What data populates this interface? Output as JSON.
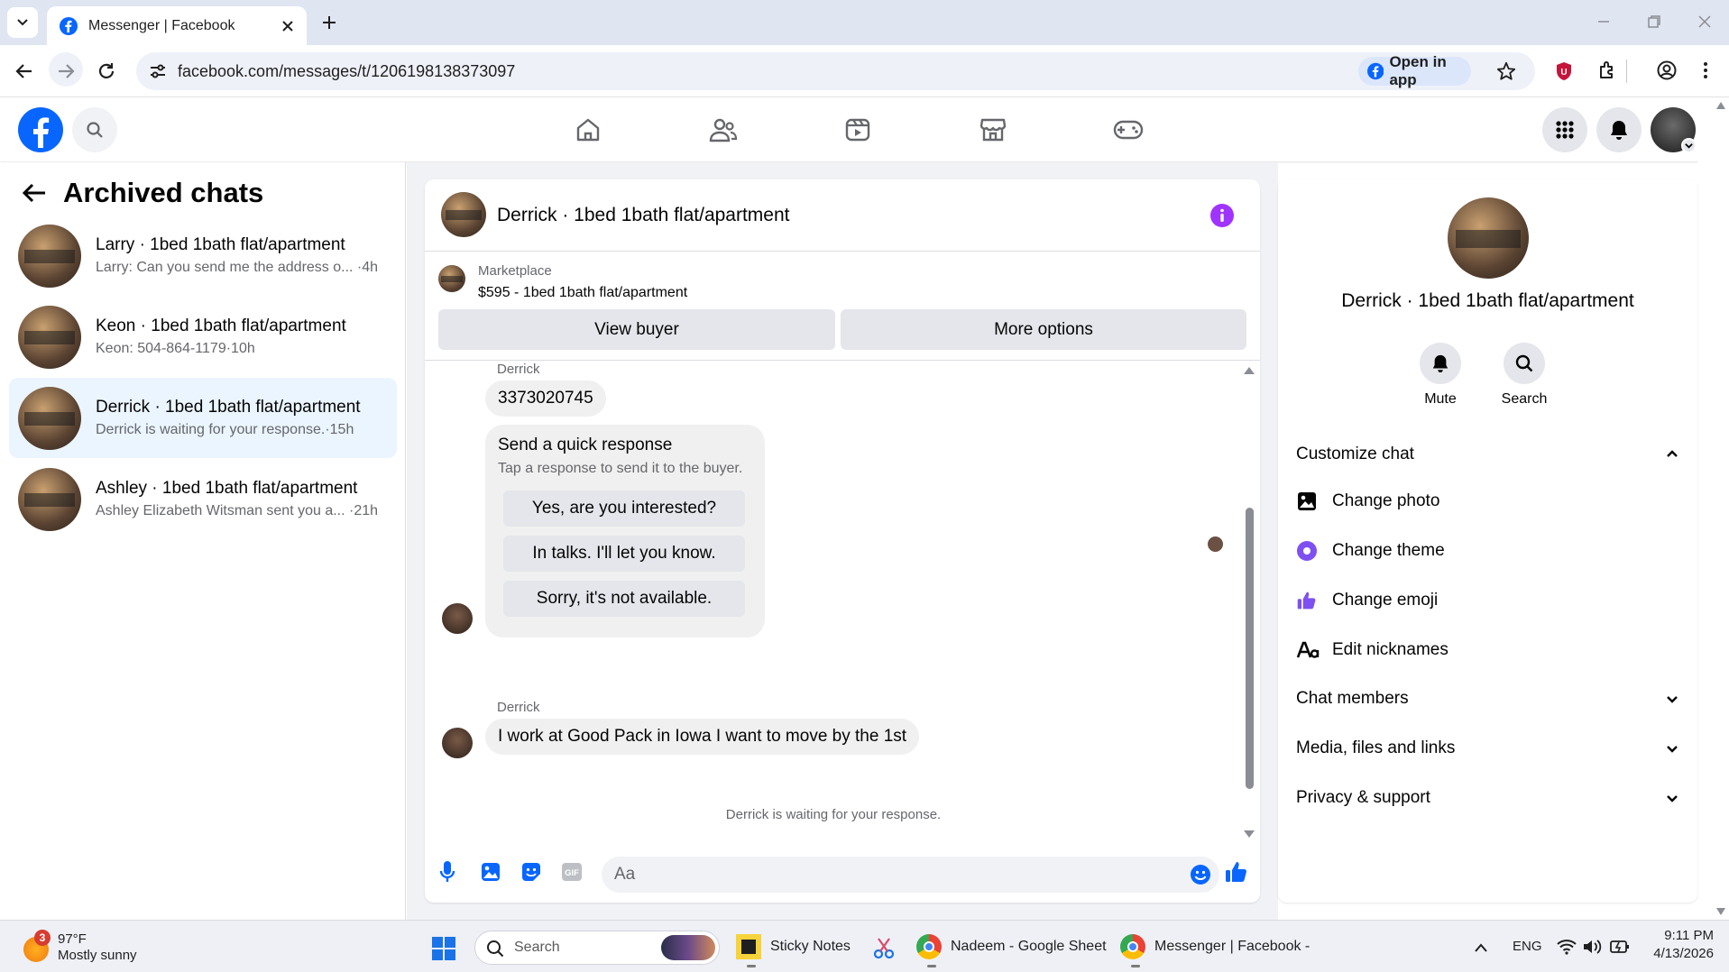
{
  "browser": {
    "tab_title": "Messenger | Facebook",
    "url": "facebook.com/messages/t/1206198138373097",
    "open_in_app": "Open in app"
  },
  "left": {
    "title": "Archived chats",
    "chats": [
      {
        "name": "Larry · 1bed 1bath flat/apartment",
        "preview": "Larry: Can you send me the address o... ·4h"
      },
      {
        "name": "Keon · 1bed 1bath flat/apartment",
        "preview": "Keon: 504-864-1179·10h"
      },
      {
        "name": "Derrick · 1bed 1bath flat/apartment",
        "preview": "Derrick is waiting for your response.·15h"
      },
      {
        "name": "Ashley · 1bed 1bath flat/apartment",
        "preview": "Ashley Elizabeth Witsman sent you a... ·21h"
      }
    ]
  },
  "chat": {
    "title": "Derrick · 1bed 1bath flat/apartment",
    "marketplace_label": "Marketplace",
    "listing": "$595 - 1bed 1bath flat/apartment",
    "view_buyer": "View buyer",
    "more_options": "More options",
    "sender1": "Derrick",
    "msg1": "3373020745",
    "quick_title": "Send a quick response",
    "quick_sub": "Tap a response to send it to the buyer.",
    "quick_options": [
      "Yes, are you interested?",
      "In talks. I'll let you know.",
      "Sorry, it's not available."
    ],
    "sender2": "Derrick",
    "msg2": "I work at Good Pack in Iowa I want to move by the 1st",
    "waiting": "Derrick is waiting for your response.",
    "input_placeholder": "Aa"
  },
  "right": {
    "name": "Derrick · 1bed 1bath flat/apartment",
    "mute": "Mute",
    "search": "Search",
    "customize": "Customize chat",
    "items": [
      "Change photo",
      "Change theme",
      "Change emoji",
      "Edit nicknames"
    ],
    "sections": [
      "Chat members",
      "Media, files and links",
      "Privacy & support"
    ]
  },
  "taskbar": {
    "weather_badge": "3",
    "temp": "97°F",
    "condition": "Mostly sunny",
    "search": "Search",
    "apps": [
      "Sticky Notes",
      "Nadeem - Google Sheet",
      "Messenger | Facebook -"
    ],
    "lang": "ENG",
    "time": "9:11 PM",
    "date": "4/13/2026"
  },
  "colors": {
    "fb_blue": "#0866ff",
    "accent_purple": "#a033ff",
    "theme_purple": "#7e50f2"
  }
}
